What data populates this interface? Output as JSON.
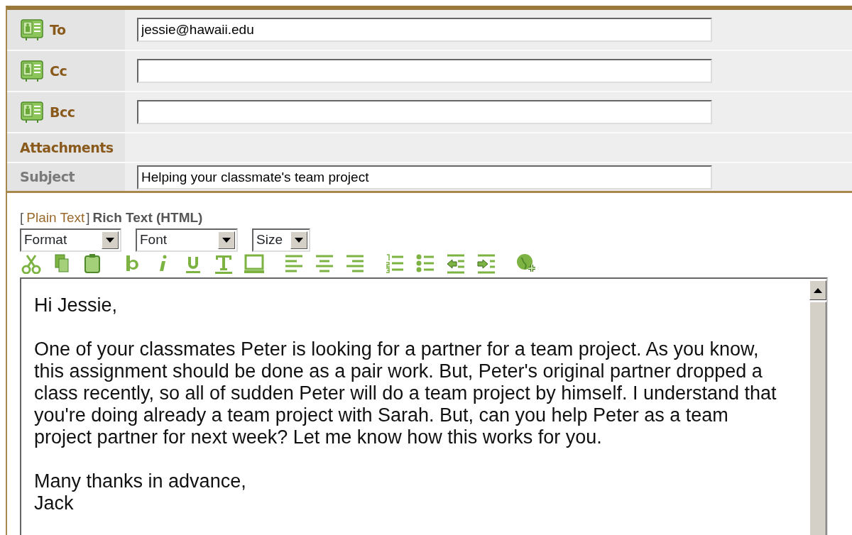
{
  "header_rows": [
    {
      "kind": "address",
      "label": "To",
      "value": "jessie@hawaii.edu"
    },
    {
      "kind": "address",
      "label": "Cc"
    },
    {
      "kind": "address",
      "label": "Bcc"
    },
    {
      "kind": "attachments",
      "label": "Attachments"
    },
    {
      "kind": "subject",
      "label": "Subject",
      "value": "Helping your classmate's team project"
    }
  ],
  "editor_modes": [
    {
      "label": "Plain Text",
      "selected": false,
      "bracket_open": "[",
      "bracket_close": "]"
    },
    {
      "label": "Rich Text (HTML)",
      "selected": true
    }
  ],
  "dropdowns": [
    {
      "label": "Format"
    },
    {
      "label": "Font"
    },
    {
      "label": "Size"
    }
  ],
  "body": [
    "Hi Jessie,",
    "One of your classmates Peter is looking for a partner for a team project. As you know, this assignment should be done as a pair work. But, Peter's original partner dropped a class recently, so all of sudden Peter will do a team project by himself. I understand that you're doing already a team project with Sarah. But, can you help Peter as a team project partner for next week? Let me know how this works for you.",
    "Many thanks in advance,\nJack"
  ]
}
